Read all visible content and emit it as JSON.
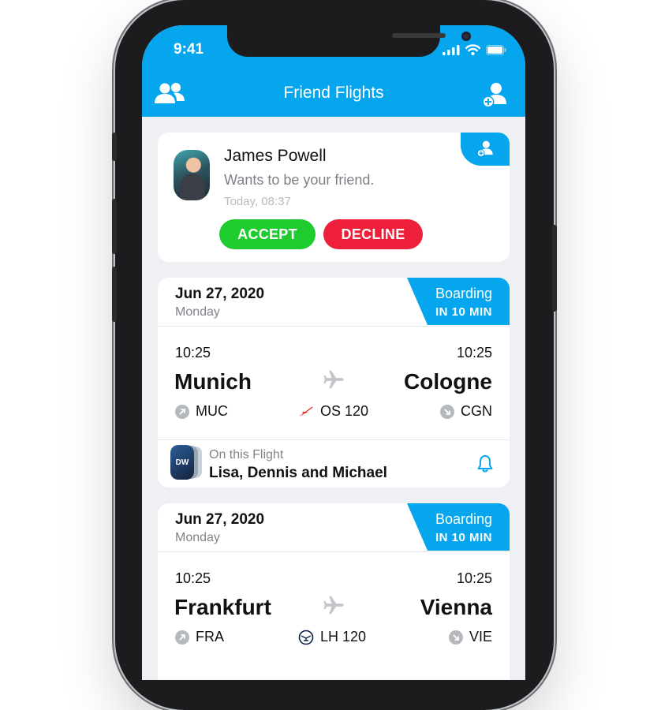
{
  "status_bar": {
    "time": "9:41"
  },
  "header": {
    "title": "Friend Flights"
  },
  "friend_request": {
    "name": "James Powell",
    "message": "Wants to be your friend.",
    "time": "Today, 08:37",
    "accept_label": "ACCEPT",
    "decline_label": "DECLINE"
  },
  "flights": [
    {
      "date": "Jun 27, 2020",
      "day": "Monday",
      "boarding_label": "Boarding",
      "boarding_time": "IN 10 MIN",
      "departure_time": "10:25",
      "arrival_time": "10:25",
      "departure_city": "Munich",
      "arrival_city": "Cologne",
      "departure_code": "MUC",
      "arrival_code": "CGN",
      "flight_number": "OS 120",
      "airline_icon": "austrian-airlines-logo",
      "on_flight_label": "On this Flight",
      "on_flight_names": "Lisa, Dennis and Michael",
      "friend_initials": "DW"
    },
    {
      "date": "Jun 27, 2020",
      "day": "Monday",
      "boarding_label": "Boarding",
      "boarding_time": "IN 10 MIN",
      "departure_time": "10:25",
      "arrival_time": "10:25",
      "departure_city": "Frankfurt",
      "arrival_city": "Vienna",
      "departure_code": "FRA",
      "arrival_code": "VIE",
      "flight_number": "LH 120",
      "airline_icon": "lufthansa-logo"
    }
  ],
  "colors": {
    "accent": "#06a6ee",
    "accept": "#1fcc2f",
    "decline": "#ee1f3a",
    "background": "#eef0f3"
  }
}
